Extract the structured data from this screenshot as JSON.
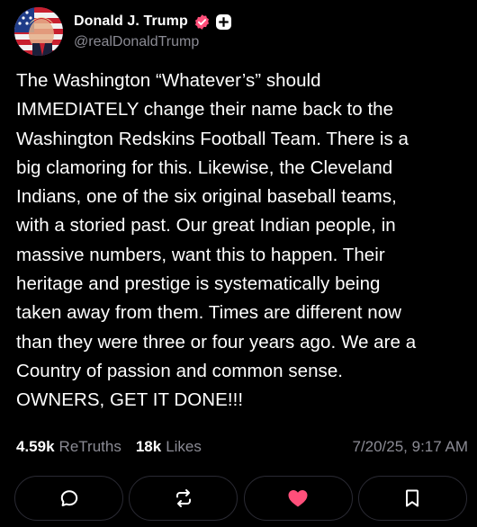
{
  "post": {
    "author_name": "Donald J. Trump",
    "handle": "@realDonaldTrump",
    "body": "The Washington “Whatever’s” should\nIMMEDIATELY change their name back to the\nWashington Redskins Football Team. There is a\nbig clamoring for this. Likewise, the Cleveland\nIndians, one of the six original baseball teams,\nwith a storied past. Our great Indian people, in\nmassive numbers, want this to happen. Their\nheritage and prestige is systematically being\ntaken away from them. Times are different now\nthan they were three or four years ago. We are a\nCountry of passion and common sense.\nOWNERS, GET IT DONE!!!",
    "retruths_count": "4.59k",
    "retruths_label": "ReTruths",
    "likes_count": "18k",
    "likes_label": "Likes",
    "timestamp": "7/20/25, 9:17 AM"
  },
  "icons": {
    "verified": "verified-badge-icon",
    "plus": "plus-icon",
    "reply": "comment-icon",
    "retruth": "retruth-icon",
    "like": "heart-icon",
    "bookmark": "bookmark-icon"
  },
  "colors": {
    "background": "#000000",
    "text": "#ffffff",
    "muted": "#8b8b94",
    "accent": "#ff4f7a",
    "border": "#2a2a33"
  }
}
